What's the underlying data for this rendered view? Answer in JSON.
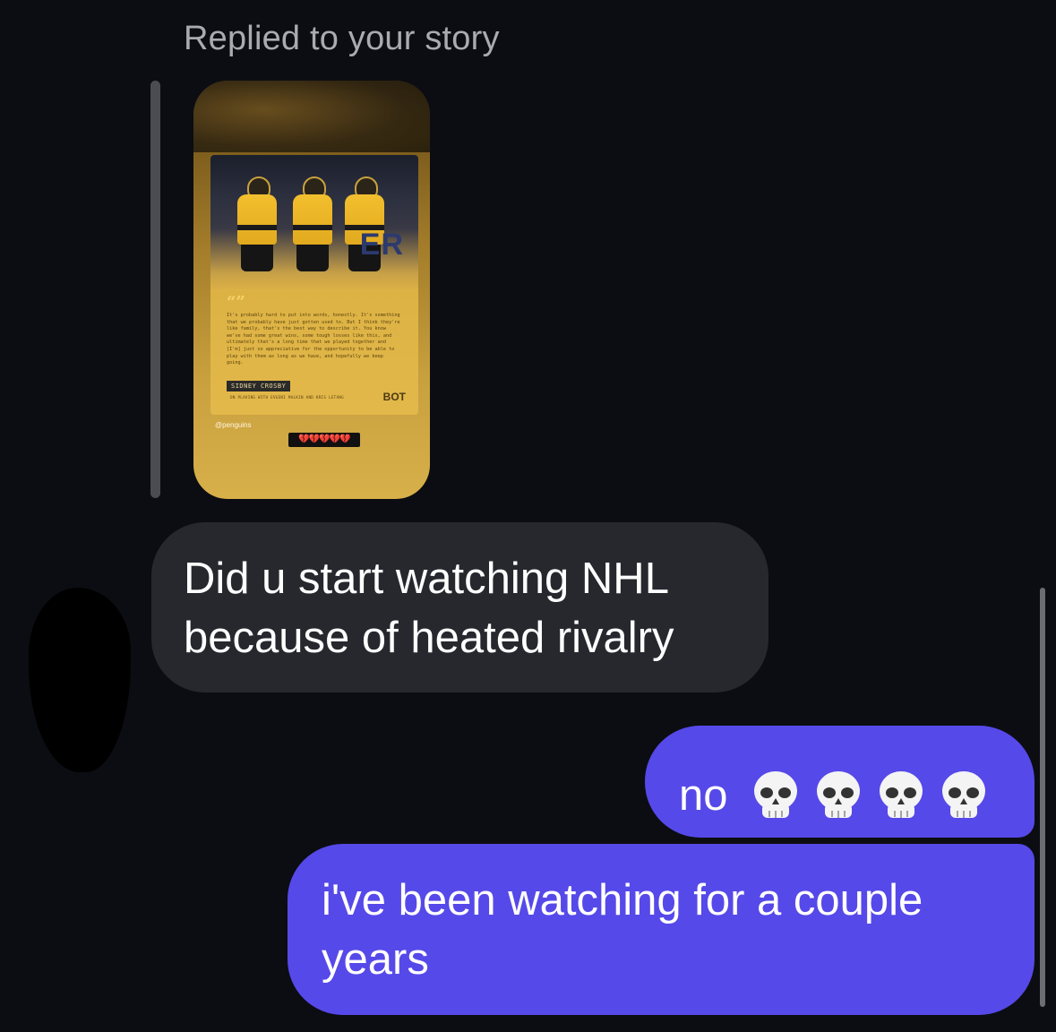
{
  "reply": {
    "header": "Replied to your story"
  },
  "story": {
    "quote_mark": "“”",
    "quote": "It's probably hard to put into words, honestly. It's something that we probably have just gotten used to. But I think they're like family, that's the best way to describe it. You know we've had some great wins, some tough losses like this, and ultimately that's a long time that we played together and [I'm] just so appreciative for the opportunity to be able to play with them as long as we have, and hopefully we keep going.",
    "name": "SIDNEY CROSBY",
    "subline": "ON PLAVING WITH EVGENI MALKIN AND KRIS LETANG",
    "brand": "BOT",
    "board_text": "ER",
    "handle": "@penguins",
    "reaction": "💔💔💔💔💔"
  },
  "messages": [
    {
      "direction": "incoming",
      "text": "Did u start watching NHL because of heated rivalry"
    },
    {
      "direction": "outgoing",
      "text": "no",
      "emoji": [
        "skull-icon",
        "skull-icon",
        "skull-icon",
        "skull-icon"
      ]
    },
    {
      "direction": "outgoing",
      "text": "i've been watching for a couple years"
    }
  ],
  "colors": {
    "background": "#0c0d12",
    "incoming_bubble": "#26282e",
    "outgoing_bubble": "#5649e9",
    "header_text": "#a9abb2"
  }
}
